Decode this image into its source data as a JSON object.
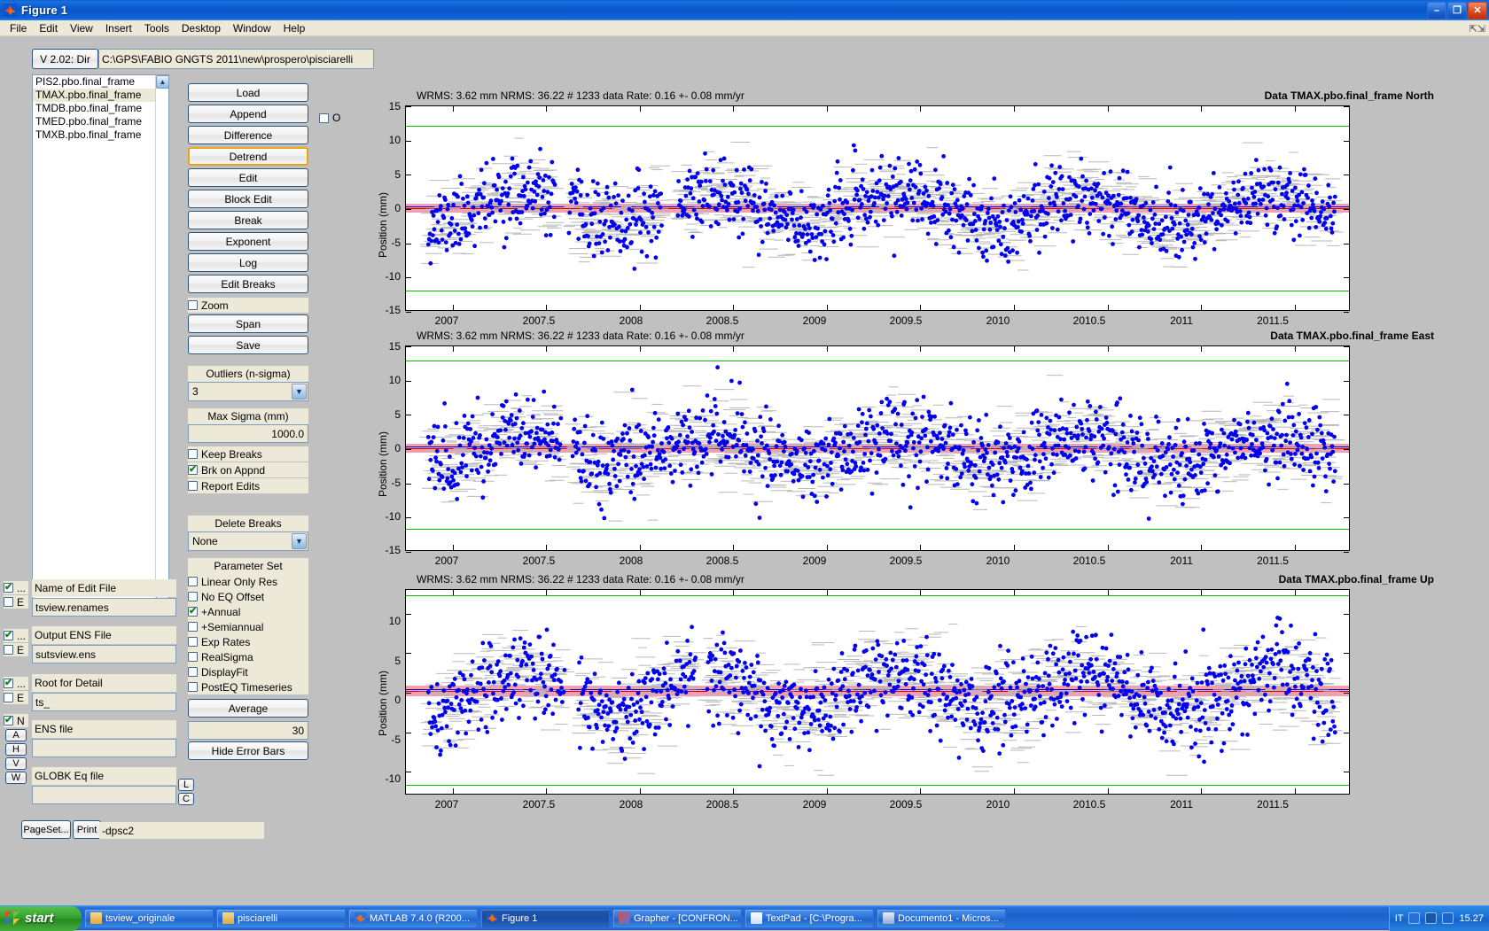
{
  "window": {
    "title": "Figure 1",
    "icon": "matlab-icon",
    "minimize": "–",
    "maximize": "❐",
    "close": "✕"
  },
  "menubar": {
    "items": [
      "File",
      "Edit",
      "View",
      "Insert",
      "Tools",
      "Desktop",
      "Window",
      "Help"
    ],
    "dock_icon": "dock-arrow-icon"
  },
  "toolbar": {
    "version_button": "V 2.02: Dir",
    "dir_path": "C:\\GPS\\FABIO GNGTS 2011\\new\\prospero\\pisciarelli"
  },
  "filelist": {
    "items": [
      {
        "label": "PIS2.pbo.final_frame",
        "selected": false
      },
      {
        "label": "TMAX.pbo.final_frame",
        "selected": true
      },
      {
        "label": "TMDB.pbo.final_frame",
        "selected": false
      },
      {
        "label": "TMED.pbo.final_frame",
        "selected": false
      },
      {
        "label": "TMXB.pbo.final_frame",
        "selected": false
      }
    ],
    "scroll_up": "▲",
    "scroll_down": "▼"
  },
  "actions": {
    "buttons": [
      {
        "label": "Load",
        "selected": false
      },
      {
        "label": "Append",
        "selected": false
      },
      {
        "label": "Difference",
        "selected": false
      },
      {
        "label": "Detrend",
        "selected": true
      },
      {
        "label": "Edit",
        "selected": false
      },
      {
        "label": "Block Edit",
        "selected": false
      },
      {
        "label": "Break",
        "selected": false
      },
      {
        "label": "Exponent",
        "selected": false
      },
      {
        "label": "Log",
        "selected": false
      },
      {
        "label": "Edit Breaks",
        "selected": false
      }
    ],
    "zoom_checkbox": {
      "label": "Zoom",
      "checked": false
    },
    "span_button": "Span",
    "save_button": "Save",
    "o_checkbox": {
      "label": "O",
      "checked": false
    }
  },
  "outliers": {
    "title": "Outliers (n-sigma)",
    "value": "3",
    "dropdown_arrow": "▼"
  },
  "maxsigma": {
    "title": "Max Sigma (mm)",
    "value": "1000.0"
  },
  "edit_options": [
    {
      "label": "Keep Breaks",
      "checked": false
    },
    {
      "label": "Brk on Appnd",
      "checked": true
    },
    {
      "label": "Report Edits",
      "checked": false
    }
  ],
  "delete_breaks": {
    "title": "Delete Breaks",
    "value": "None",
    "dropdown_arrow": "▼"
  },
  "parameter_set": {
    "title": "Parameter Set",
    "options": [
      {
        "label": "Linear Only Res",
        "checked": false
      },
      {
        "label": "No EQ Offset",
        "checked": false
      },
      {
        "label": "+Annual",
        "checked": true
      },
      {
        "label": "+Semiannual",
        "checked": false
      },
      {
        "label": "Exp Rates",
        "checked": false
      },
      {
        "label": "RealSigma",
        "checked": false
      },
      {
        "label": "DisplayFit",
        "checked": false
      },
      {
        "label": "PostEQ Timeseries",
        "checked": false
      }
    ]
  },
  "average": {
    "button": "Average",
    "value": "30",
    "hide_error_bars": "Hide Error Bars"
  },
  "files": {
    "edit_file": {
      "title": "Name of Edit File",
      "value": "tsview.renames",
      "cb1": true,
      "cb1_label": "...",
      "cb2": false,
      "cb2_label": "E"
    },
    "ens_out": {
      "title": "Output ENS File",
      "value": "sutsview.ens",
      "cb1": true,
      "cb1_label": "...",
      "cb2": false,
      "cb2_label": "E"
    },
    "root_detail": {
      "title": "Root for Detail",
      "value": "ts_",
      "cb1": true,
      "cb1_label": "...",
      "cb2": false,
      "cb2_label": "E"
    },
    "ens_file": {
      "title": "ENS file",
      "value": ""
    },
    "globk_eq": {
      "title": "GLOBK Eq file",
      "value": ""
    }
  },
  "component_buttons": {
    "n_checkbox": {
      "label": "N",
      "checked": true
    },
    "buttons": [
      "A",
      "H",
      "V",
      "W"
    ]
  },
  "globk_side_buttons": [
    "L",
    "C"
  ],
  "print": {
    "pageset_button": "PageSet...",
    "print_button": "Print",
    "print_value": "-dpsc2"
  },
  "plots": [
    {
      "header": "WRMS:    3.62 mm NRMS: 36.22 #   1233 data  Rate:     0.16 +-   0.08 mm/yr",
      "title": "Data TMAX.pbo.final_frame North",
      "ylabel": "Position (mm)",
      "yticks": [
        "15",
        "10",
        "5",
        "0",
        "-5",
        "-10",
        "-15"
      ],
      "xticks": [
        "2007",
        "2007.5",
        "2008",
        "2008.5",
        "2009",
        "2009.5",
        "2010",
        "2010.5",
        "2011",
        "2011.5"
      ],
      "show_xlabels": true
    },
    {
      "header": "WRMS:    3.62 mm NRMS: 36.22 #   1233 data  Rate:     0.16 +-   0.08 mm/yr",
      "title": "Data TMAX.pbo.final_frame East",
      "ylabel": "Position (mm)",
      "yticks": [
        "15",
        "10",
        "5",
        "0",
        "-5",
        "-10",
        "-15"
      ],
      "xticks": [
        "2007",
        "2007.5",
        "2008",
        "2008.5",
        "2009",
        "2009.5",
        "2010",
        "2010.5",
        "2011",
        "2011.5"
      ],
      "show_xlabels": true
    },
    {
      "header": "WRMS:    3.62 mm NRMS: 36.22 #   1233 data  Rate:     0.16 +-   0.08 mm/yr",
      "title": "Data TMAX.pbo.final_frame Up",
      "ylabel": "Position (mm)",
      "yticks": [
        "10",
        "5",
        "0",
        "-5",
        "-10"
      ],
      "xticks": [
        "2007",
        "2007.5",
        "2008",
        "2008.5",
        "2009",
        "2009.5",
        "2010",
        "2010.5",
        "2011",
        "2011.5"
      ],
      "show_xlabels": true
    }
  ],
  "chart_data": {
    "type": "scatter",
    "title": "GPS Position Time Series - TMAX.pbo.final_frame",
    "xlabel": "",
    "ylabel": "Position (mm)",
    "xlim": [
      2006.75,
      2011.8
    ],
    "ylim": [
      -15,
      15
    ],
    "grid": false,
    "legend": "none",
    "marker_color": "#0000ee",
    "errorbar_color": "#b0b0b0",
    "fit_color": "#cc0000",
    "sigma_band_color": "#f0a0b0",
    "outlier_limit_color": "#00c000",
    "panels": [
      {
        "component": "North",
        "wrms_mm": 3.62,
        "nrms": 36.22,
        "n_data": 1233,
        "rate_mm_per_yr": 0.16,
        "rate_sigma_mm_per_yr": 0.08,
        "ylim": [
          -15,
          15
        ],
        "yticks": [
          15,
          10,
          5,
          0,
          -5,
          -10,
          -15
        ],
        "outlier_lines": [
          10.4,
          -10.4
        ],
        "fit_level": 0
      },
      {
        "component": "East",
        "wrms_mm": 3.62,
        "nrms": 36.22,
        "n_data": 1233,
        "rate_mm_per_yr": 0.16,
        "rate_sigma_mm_per_yr": 0.08,
        "ylim": [
          -15,
          15
        ],
        "yticks": [
          15,
          10,
          5,
          0,
          -5,
          -10,
          -15
        ],
        "outlier_lines": [
          11.2,
          -10.2
        ],
        "fit_level": 0
      },
      {
        "component": "Up",
        "wrms_mm": 3.62,
        "nrms": 36.22,
        "n_data": 1233,
        "rate_mm_per_yr": 0.16,
        "rate_sigma_mm_per_yr": 0.08,
        "ylim": [
          -13,
          13
        ],
        "yticks": [
          10,
          5,
          0,
          -5,
          -10
        ],
        "outlier_lines": [
          12.4,
          -11.6
        ],
        "fit_level": 0
      }
    ],
    "xticks": [
      2007,
      2007.5,
      2008,
      2008.5,
      2009,
      2009.5,
      2010,
      2010.5,
      2011,
      2011.5
    ]
  },
  "taskbar": {
    "start": "start",
    "items": [
      {
        "label": "tsview_originale",
        "icon": "folder-icon",
        "active": false
      },
      {
        "label": "pisciarelli",
        "icon": "folder-icon",
        "active": false
      },
      {
        "label": "MATLAB 7.4.0 (R200...",
        "icon": "matlab-icon",
        "active": false
      },
      {
        "label": "Figure 1",
        "icon": "matlab-icon",
        "active": true
      },
      {
        "label": "Grapher - [CONFRON...",
        "icon": "grapher-icon",
        "active": false
      },
      {
        "label": "TextPad - [C:\\Progra...",
        "icon": "textpad-icon",
        "active": false
      },
      {
        "label": "Documento1 - Micros...",
        "icon": "word-icon",
        "active": false
      }
    ],
    "lang": "IT",
    "clock": "15.27",
    "tray_icons": [
      "volume-icon",
      "network-icon",
      "shield-icon"
    ]
  }
}
